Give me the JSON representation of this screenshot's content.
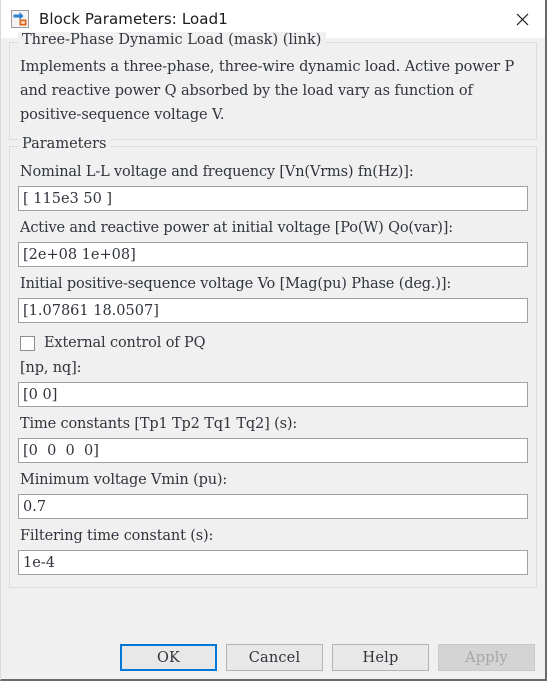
{
  "window": {
    "title": "Block Parameters: Load1",
    "icon": "simulink-block-icon",
    "close_icon": "close-icon"
  },
  "mask_group": {
    "legend": "Three-Phase Dynamic Load (mask) (link)",
    "description": "Implements a three-phase, three-wire dynamic load. Active power P and reactive power Q absorbed by the load vary as function of positive-sequence voltage V."
  },
  "parameters_group": {
    "legend": "Parameters",
    "fields": [
      {
        "label": "Nominal L-L voltage and frequency  [Vn(Vrms) fn(Hz)]:",
        "value": "[ 115e3 50 ]",
        "name": "nominal-voltage-frequency"
      },
      {
        "label": "Active and reactive power at initial voltage [Po(W) Qo(var)]:",
        "value": "[2e+08 1e+08]",
        "name": "active-reactive-power"
      },
      {
        "label": "Initial positive-sequence voltage Vo [Mag(pu) Phase (deg.)]:",
        "value": "[1.07861 18.0507]",
        "name": "initial-positive-sequence-voltage"
      },
      {
        "label": "[np, nq]:",
        "value": "[0 0]",
        "name": "np-nq"
      },
      {
        "label": "Time constants [Tp1 Tp2 Tq1 Tq2]  (s):",
        "value": "[0  0  0  0]",
        "name": "time-constants"
      },
      {
        "label": "Minimum voltage Vmin (pu):",
        "value": "0.7",
        "name": "minimum-voltage"
      },
      {
        "label": "Filtering time constant (s):",
        "value": "1e-4",
        "name": "filtering-time-constant"
      }
    ],
    "checkbox": {
      "label": "External control of PQ",
      "checked": false,
      "name": "external-control-pq"
    }
  },
  "buttons": {
    "ok": "OK",
    "cancel": "Cancel",
    "help": "Help",
    "apply": "Apply"
  },
  "colors": {
    "focus_blue": "#0078d7",
    "dialog_bg": "#f0f0f0",
    "text": "#30343c"
  }
}
